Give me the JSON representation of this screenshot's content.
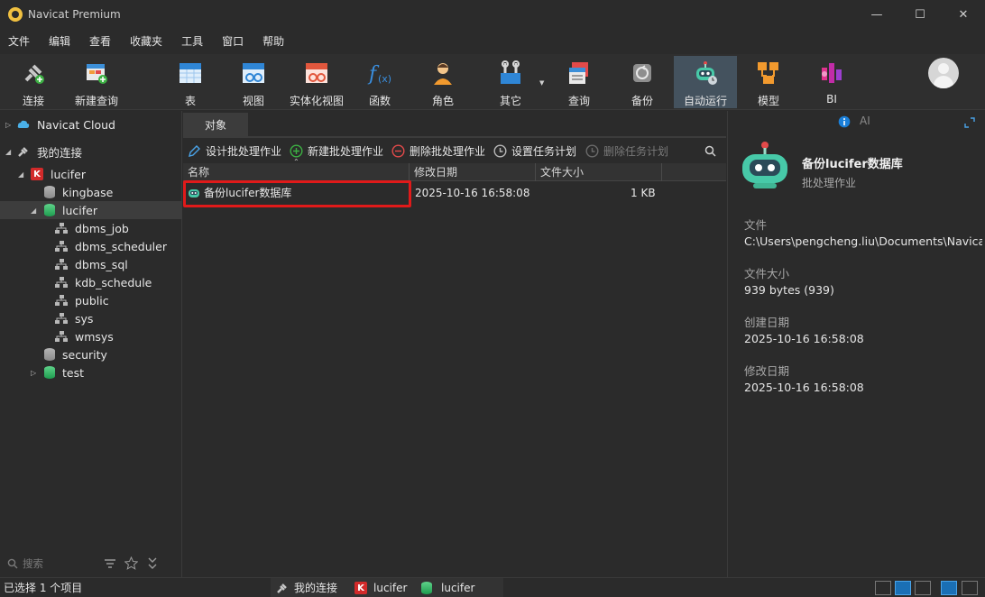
{
  "window": {
    "title": "Navicat Premium",
    "min_icon": "minimize-icon",
    "max_icon": "maximize-icon",
    "close_icon": "close-icon"
  },
  "menu": [
    "文件",
    "编辑",
    "查看",
    "收藏夹",
    "工具",
    "窗口",
    "帮助"
  ],
  "toolbar": [
    {
      "label": "连接",
      "icon": "connect-icon"
    },
    {
      "label": "新建查询",
      "icon": "new-query-icon"
    },
    {
      "label": "表",
      "icon": "table-icon"
    },
    {
      "label": "视图",
      "icon": "view-icon"
    },
    {
      "label": "实体化视图",
      "icon": "materialized-view-icon"
    },
    {
      "label": "函数",
      "icon": "function-icon"
    },
    {
      "label": "角色",
      "icon": "role-icon"
    },
    {
      "label": "其它",
      "icon": "other-icon"
    },
    {
      "label": "查询",
      "icon": "query-icon"
    },
    {
      "label": "备份",
      "icon": "backup-icon"
    },
    {
      "label": "自动运行",
      "icon": "automation-icon",
      "active": true
    },
    {
      "label": "模型",
      "icon": "model-icon"
    },
    {
      "label": "BI",
      "icon": "bi-icon"
    }
  ],
  "sidebar": {
    "tree": [
      {
        "label": "Navicat Cloud"
      },
      {
        "label": "我的连接"
      },
      {
        "label": "lucifer"
      },
      {
        "label": "kingbase"
      },
      {
        "label": "lucifer"
      },
      {
        "label": "dbms_job"
      },
      {
        "label": "dbms_scheduler"
      },
      {
        "label": "dbms_sql"
      },
      {
        "label": "kdb_schedule"
      },
      {
        "label": "public"
      },
      {
        "label": "sys"
      },
      {
        "label": "wmsys"
      },
      {
        "label": "security"
      },
      {
        "label": "test"
      }
    ],
    "search_placeholder": "搜索"
  },
  "center": {
    "tab": "对象",
    "actions": {
      "design": "设计批处理作业",
      "new": "新建批处理作业",
      "delete": "删除批处理作业",
      "schedule": "设置任务计划",
      "unschedule": "删除任务计划"
    },
    "columns": [
      "名称",
      "修改日期",
      "文件大小"
    ],
    "rows": [
      {
        "name": "备份lucifer数据库",
        "modified": "2025-10-16 16:58:08",
        "size": "1 KB"
      }
    ]
  },
  "info": {
    "ai_label": "AI",
    "title": "备份lucifer数据库",
    "subtitle": "批处理作业",
    "file_label": "文件",
    "file_value": "C:\\Users\\pengcheng.liu\\Documents\\Navicat\\",
    "size_label": "文件大小",
    "size_value": "939 bytes (939)",
    "created_label": "创建日期",
    "created_value": "2025-10-16 16:58:08",
    "modified_label": "修改日期",
    "modified_value": "2025-10-16 16:58:08"
  },
  "status": {
    "selected": "已选择 1 个项目",
    "conn_group": "我的连接",
    "conn": "lucifer",
    "db": "lucifer"
  },
  "colors": {
    "accent": "#1a6fb5",
    "highlight": "#e01a1a",
    "active_tool": "#44525e"
  }
}
